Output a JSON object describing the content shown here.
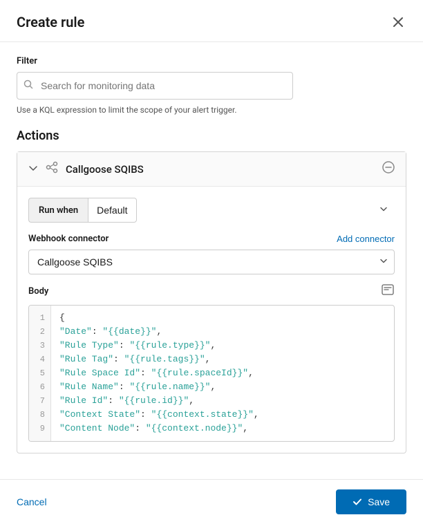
{
  "modal": {
    "title": "Create rule",
    "close_label": "×"
  },
  "filter": {
    "label": "Filter",
    "search_placeholder": "Search for monitoring data",
    "hint": "Use a KQL expression to limit the scope of your alert trigger."
  },
  "actions": {
    "title": "Actions",
    "action_card": {
      "name": "Callgoose SQIBS",
      "run_when_label": "Run when",
      "run_when_value": "Default",
      "webhook_label": "Webhook connector",
      "add_connector_label": "Add connector",
      "connector_value": "Callgoose SQIBS",
      "body_label": "Body",
      "code_lines": [
        {
          "num": "1",
          "content": "{"
        },
        {
          "num": "2",
          "content": "\"Date\": \"{{date}}\","
        },
        {
          "num": "3",
          "content": "\"Rule Type\": \"{{rule.type}}\","
        },
        {
          "num": "4",
          "content": "\"Rule Tag\": \"{{rule.tags}}\","
        },
        {
          "num": "5",
          "content": "\"Rule Space Id\": \"{{rule.spaceId}}\","
        },
        {
          "num": "6",
          "content": "\"Rule Name\": \"{{rule.name}}\","
        },
        {
          "num": "7",
          "content": "\"Rule Id\": \"{{rule.id}}\","
        },
        {
          "num": "8",
          "content": "\"Context State\": \"{{context.state}}\","
        },
        {
          "num": "9",
          "content": "\"Content Node\": \"{{context.node}}\","
        }
      ]
    }
  },
  "footer": {
    "cancel_label": "Cancel",
    "save_label": "Save"
  }
}
